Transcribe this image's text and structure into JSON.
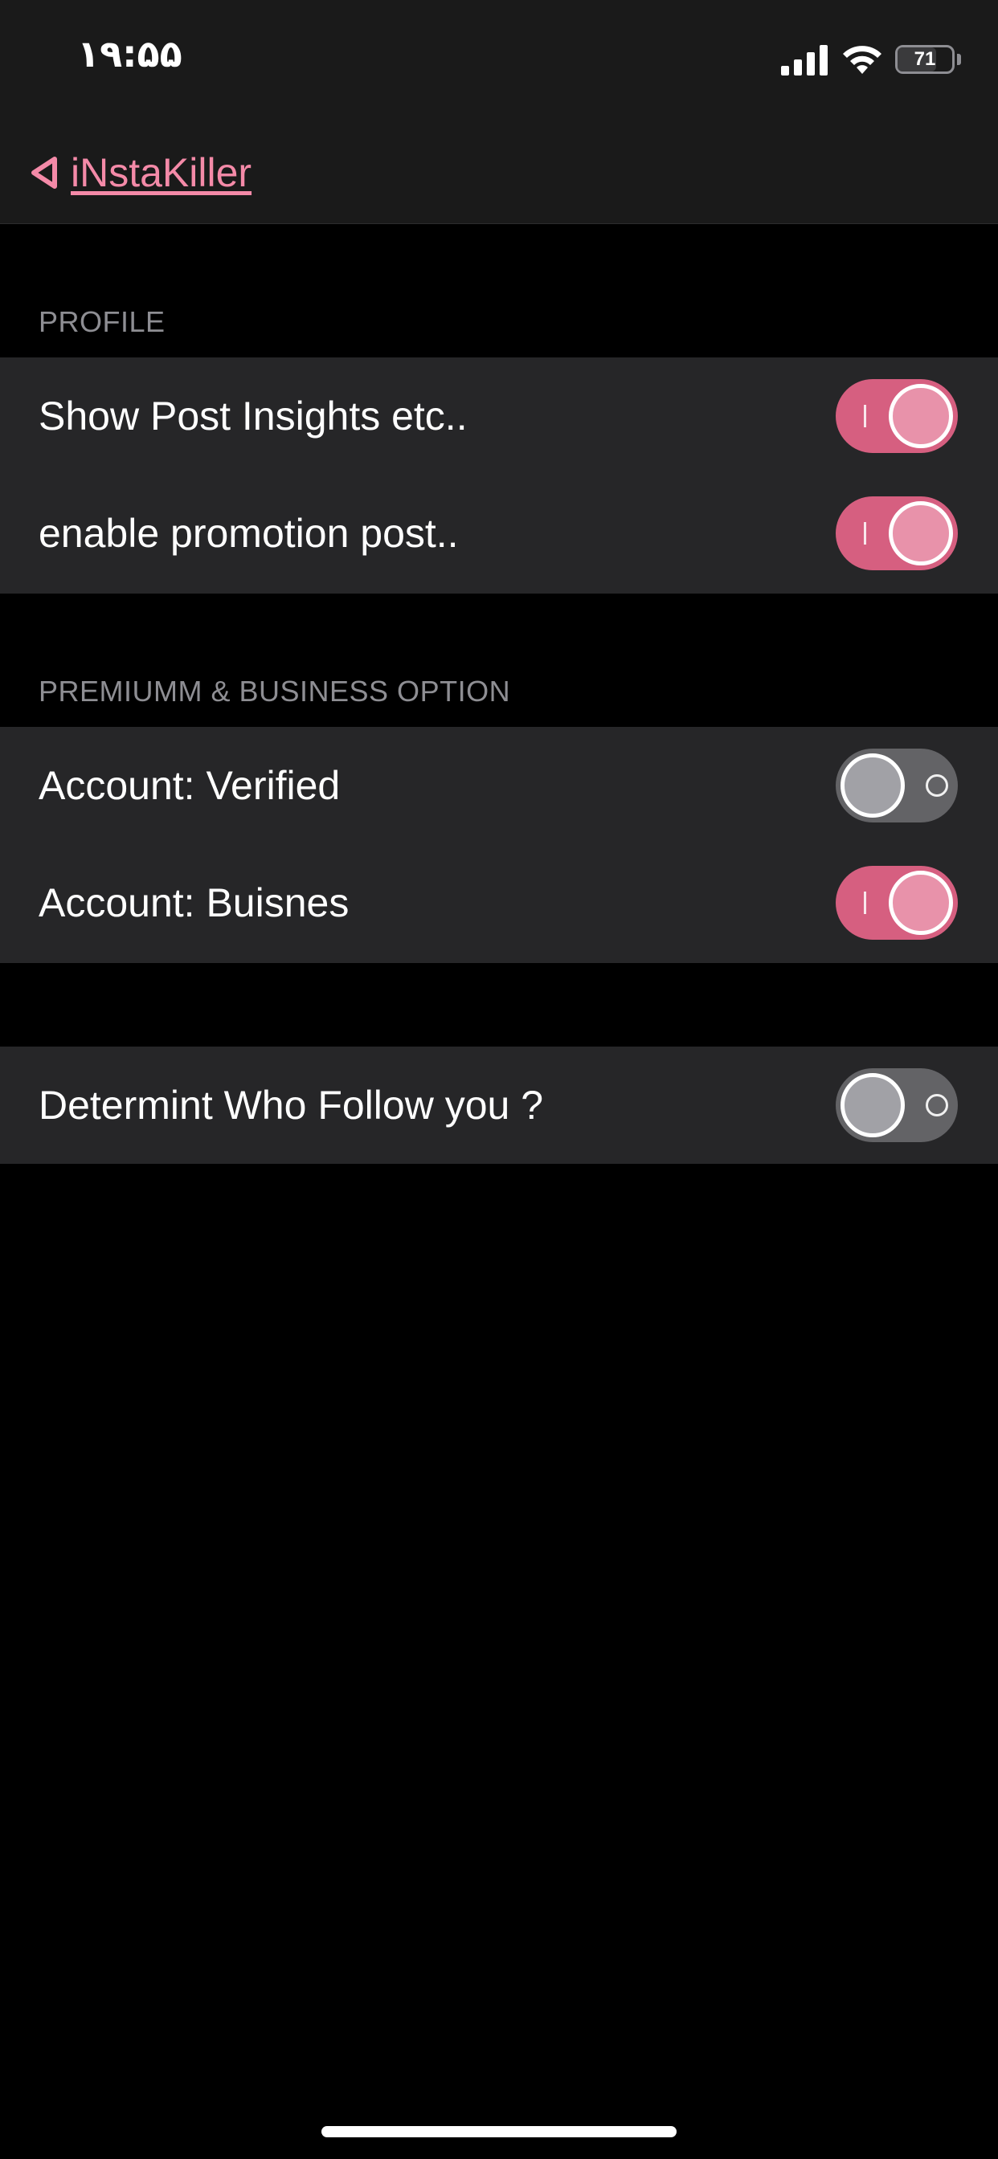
{
  "status_bar": {
    "time": "۱۹:۵۵",
    "battery": "71",
    "icons": [
      "signal-icon",
      "wifi-icon",
      "battery-icon"
    ]
  },
  "nav": {
    "back_label": "iNstaKiller",
    "back_icon": "back-triangle-icon"
  },
  "colors": {
    "accent": "#f48aa8",
    "toggle_on": "#d65f80",
    "toggle_off": "#636366",
    "group_bg": "#262628"
  },
  "sections": [
    {
      "header": "PROFILE",
      "rows": [
        {
          "label": "Show Post Insights etc..",
          "on": true
        },
        {
          "label": "enable promotion post..",
          "on": true
        }
      ]
    },
    {
      "header": "PREMIUMM & BUSINESS OPTION",
      "rows": [
        {
          "label": "Account: Verified",
          "on": false
        },
        {
          "label": "Account: Buisnes",
          "on": true
        }
      ]
    },
    {
      "header": "",
      "rows": [
        {
          "label": "Determint Who Follow you ?",
          "on": false
        }
      ]
    }
  ]
}
